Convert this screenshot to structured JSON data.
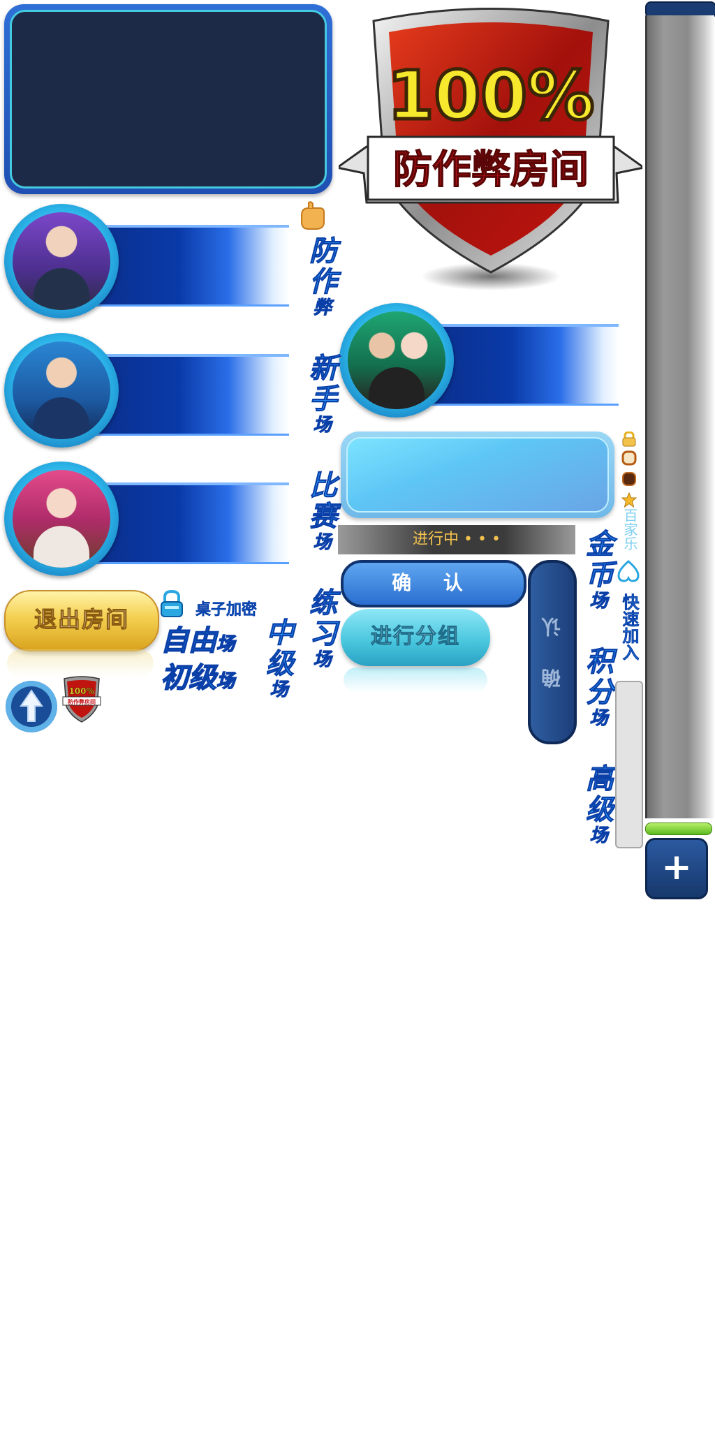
{
  "shield": {
    "percent": "100%",
    "banner": "防作弊房间"
  },
  "vertical_labels": {
    "anti_cheat_a": "防作",
    "anti_cheat_b": "弊",
    "novice_a": "新手",
    "novice_b": "场",
    "match_a": "比赛",
    "match_b": "场",
    "practice_a": "练习",
    "practice_b": "场",
    "intermediate_a": "中级",
    "intermediate_b": "场",
    "gold_a": "金币",
    "gold_b": "场",
    "points_a": "积分",
    "points_b": "场",
    "advanced_a": "高级",
    "advanced_b": "场",
    "quick_join": "快速加入",
    "baijiale": "百家乐"
  },
  "buttons": {
    "exit_room": "退出房间",
    "confirm": "确 认",
    "confirm_vertical": "确 认",
    "group": "进行分组",
    "plus": "+"
  },
  "labels": {
    "table_password": "桌子加密",
    "free_field_a": "自由",
    "free_field_b": "场",
    "primary_field_a": "初级",
    "primary_field_b": "场",
    "in_progress": "进行中 • • •"
  },
  "colors": {
    "accent_blue": "#2da0ff",
    "gold_text": "#f3c24e",
    "dark_navy": "#1c2a48"
  }
}
